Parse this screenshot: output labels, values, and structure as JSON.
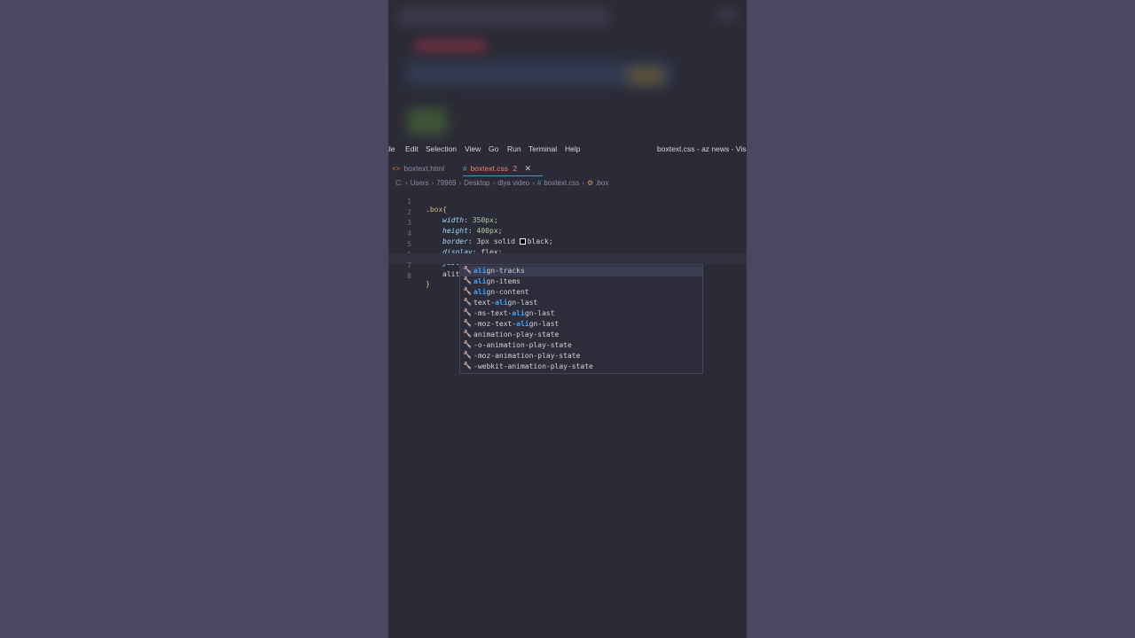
{
  "menu": {
    "items": [
      "ile",
      "Edit",
      "Selection",
      "View",
      "Go",
      "Run",
      "Terminal",
      "Help"
    ],
    "window_title": "boxtext.css - az news - Visual S"
  },
  "tabs": [
    {
      "label": "boxtext.html",
      "icon": "html-file-icon"
    },
    {
      "label": "boxtext.css",
      "badge": "2",
      "icon": "css-file-icon"
    }
  ],
  "breadcrumb": {
    "parts": [
      "C:",
      "Users",
      "79969",
      "Desktop",
      "dlya video"
    ],
    "file": "boxtext.css",
    "symbol": ".box"
  },
  "editor": {
    "line_numbers": [
      "1",
      "2",
      "3",
      "4",
      "5",
      "6",
      "7",
      "8"
    ],
    "selector": ".box",
    "open_brace": "{",
    "close_brace": "}",
    "decls": [
      {
        "prop": "width",
        "value": "350px"
      },
      {
        "prop": "height",
        "value": "400px"
      },
      {
        "prop": "border",
        "value_pre": "3px solid ",
        "value_post": "black"
      },
      {
        "prop": "display",
        "value": "flex"
      },
      {
        "prop": "justify-content",
        "value": "center"
      }
    ],
    "typing": "alit"
  },
  "suggestions": [
    {
      "pre": "",
      "match": "ali",
      "post": "gn-tracks"
    },
    {
      "pre": "",
      "match": "ali",
      "post": "gn-items"
    },
    {
      "pre": "",
      "match": "ali",
      "post": "gn-content"
    },
    {
      "pre": "text-",
      "match": "ali",
      "post": "gn-last"
    },
    {
      "pre": "-ms-text-",
      "match": "ali",
      "post": "gn-last"
    },
    {
      "pre": "-moz-text-",
      "match": "ali",
      "post": "gn-last"
    },
    {
      "pre": "animation-play-state",
      "match": "",
      "post": ""
    },
    {
      "pre": "-o-animation-play-state",
      "match": "",
      "post": ""
    },
    {
      "pre": "-moz-animation-play-state",
      "match": "",
      "post": ""
    },
    {
      "pre": "-webkit-animation-play-state",
      "match": "",
      "post": ""
    }
  ]
}
